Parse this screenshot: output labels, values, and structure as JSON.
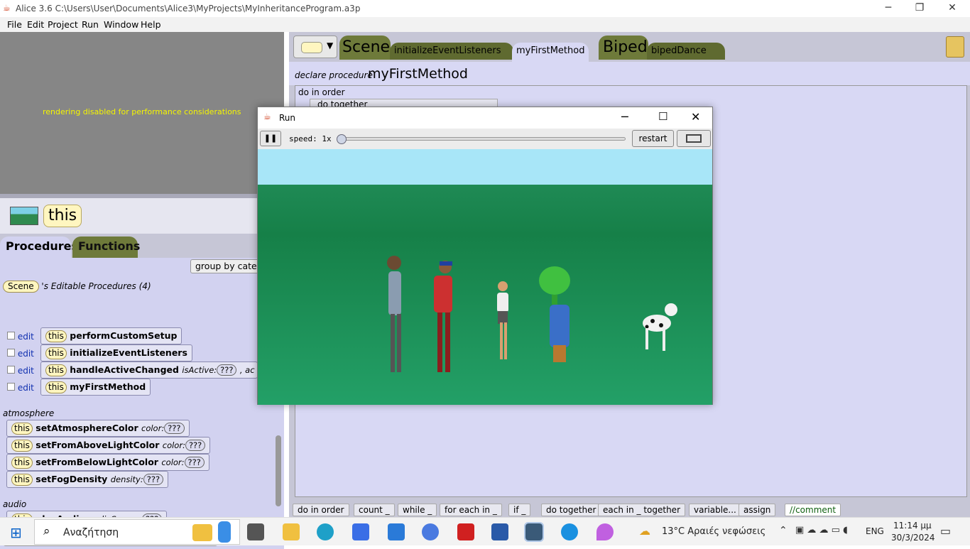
{
  "window": {
    "title": "Alice 3.6 C:\\Users\\User\\Documents\\Alice3\\MyProjects\\MyInheritanceProgram.a3p"
  },
  "menu": [
    "File",
    "Edit",
    "Project",
    "Run",
    "Window",
    "Help"
  ],
  "render_message": "rendering disabled for performance considerations",
  "this_label": "this",
  "left_tabs": {
    "procedures": "Procedures",
    "functions": "Functions"
  },
  "group_button": "group by categor",
  "scene_pill": "Scene",
  "editable_header": "'s Editable Procedures (4)",
  "edit_label": "edit",
  "editable_procs": [
    {
      "name": "performCustomSetup"
    },
    {
      "name": "initializeEventListeners"
    },
    {
      "name": "handleActiveChanged",
      "param": "isActive:",
      "value": "???",
      "extra": ", ac"
    },
    {
      "name": "myFirstMethod"
    }
  ],
  "categories": {
    "atmosphere": "atmosphere",
    "audio": "audio"
  },
  "atmosphere_procs": [
    {
      "name": "setAtmosphereColor",
      "param": "color:",
      "value": "???"
    },
    {
      "name": "setFromAboveLightColor",
      "param": "color:",
      "value": "???"
    },
    {
      "name": "setFromBelowLightColor",
      "param": "color:",
      "value": "???"
    },
    {
      "name": "setFogDensity",
      "param": "density:",
      "value": "???"
    }
  ],
  "audio_procs": [
    {
      "name": "playAudio",
      "param": "audioSource:",
      "value": "???"
    }
  ],
  "editor_tabs": {
    "scene": "Scene",
    "init": "initializeEventListeners",
    "first": "myFirstMethod",
    "biped": "Biped",
    "dance": "bipedDance"
  },
  "declare": {
    "prefix": "declare procedure",
    "name": "myFirstMethod"
  },
  "code": {
    "do_in_order": "do in order",
    "do_together": "do together"
  },
  "controls": [
    "do in order",
    "count _",
    "while _",
    "for each in _",
    "if _",
    "do together",
    "each in _ together",
    "variable...",
    "assign",
    "//comment"
  ],
  "run_window": {
    "title": "Run",
    "speed": "speed: 1x",
    "restart": "restart",
    "speed_value": 1
  },
  "taskbar": {
    "search": "Αναζήτηση",
    "weather": "13°C  Αραιές νεφώσεις",
    "lang": "ENG",
    "time": "11:14 μμ",
    "date": "30/3/2024"
  },
  "colors": {
    "left_bg": "#c6c6d6",
    "code_bg": "#d8d8f4",
    "tab_green": "#6e7a3a",
    "pill": "#fff6c0"
  }
}
